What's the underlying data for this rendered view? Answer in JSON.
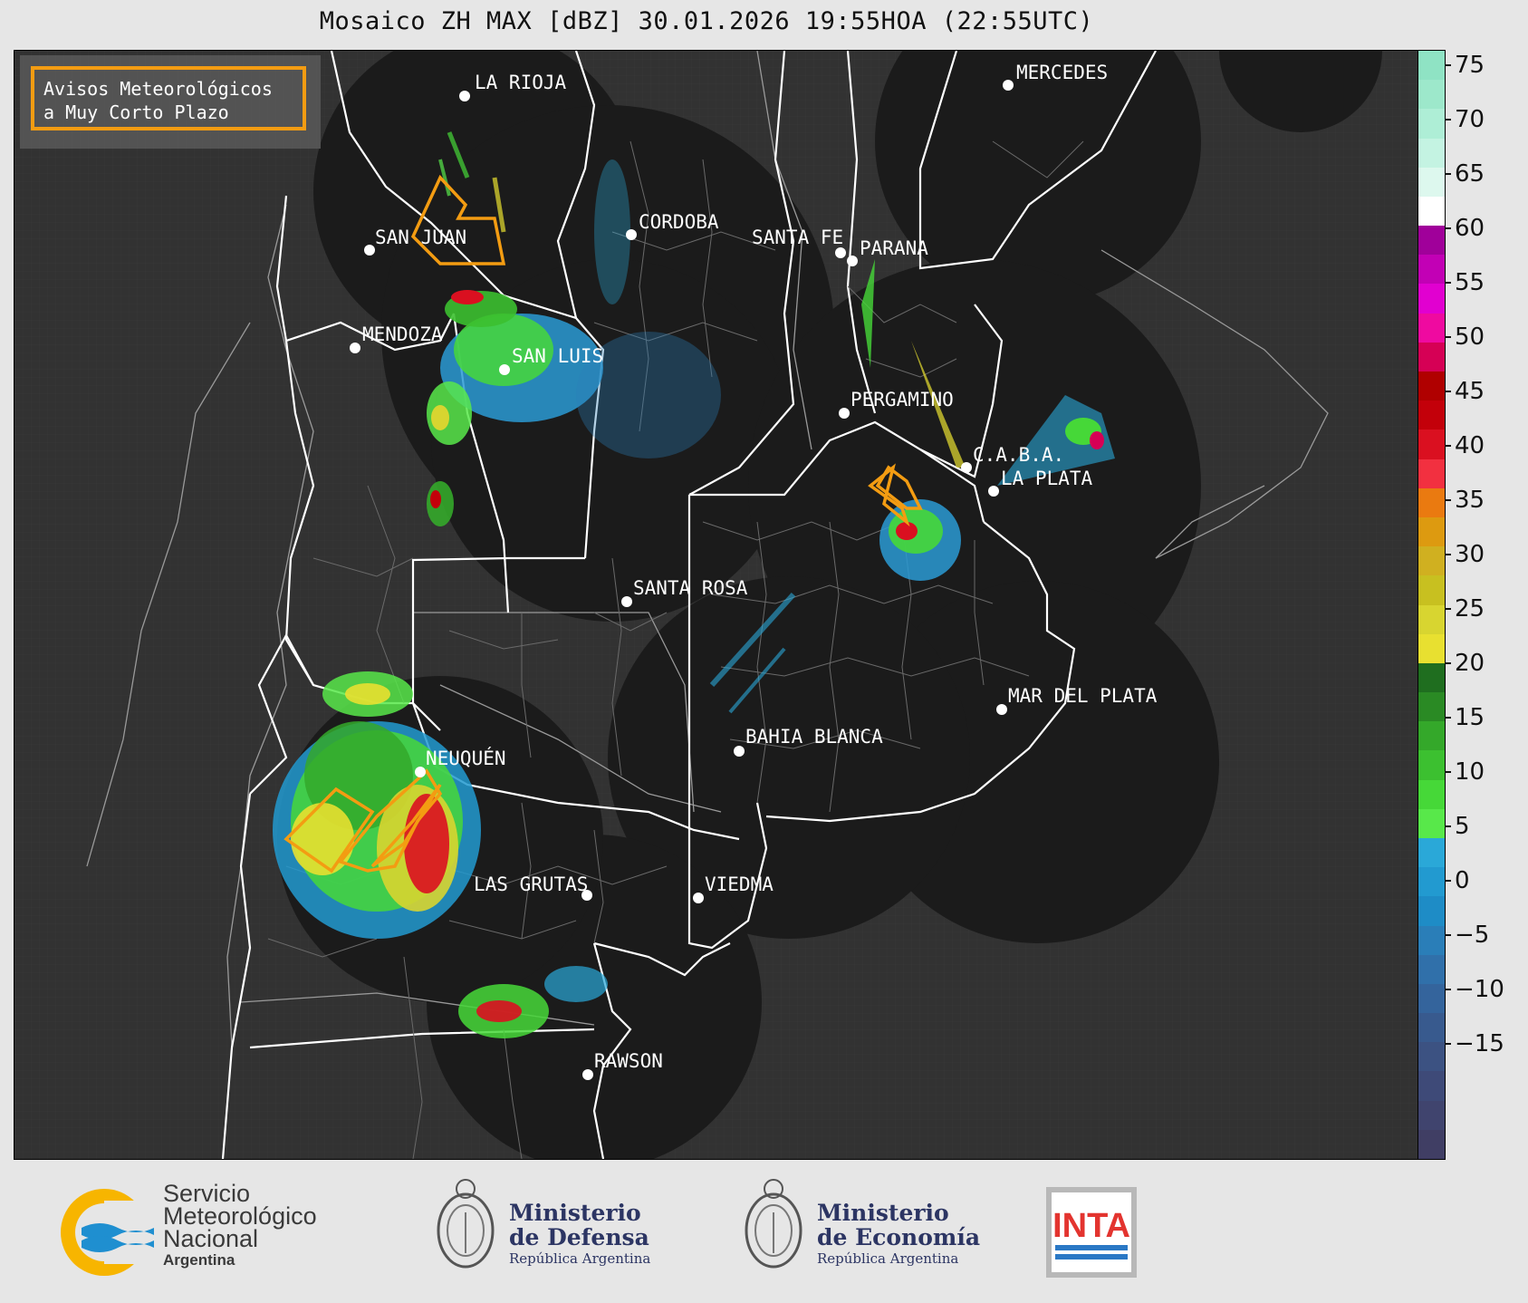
{
  "title": "Mosaico ZH MAX [dBZ] 30.01.2026 19:55HOA (22:55UTC)",
  "alert_box": {
    "line1": "Avisos Meteorológicos",
    "line2": "a Muy Corto Plazo",
    "border_color": "#f39c12"
  },
  "cities": [
    {
      "name": "LA RIOJA"
    },
    {
      "name": "SAN JUAN"
    },
    {
      "name": "CORDOBA"
    },
    {
      "name": "SANTA FE"
    },
    {
      "name": "PARANA"
    },
    {
      "name": "MERCEDES"
    },
    {
      "name": "MENDOZA"
    },
    {
      "name": "SAN LUIS"
    },
    {
      "name": "PERGAMINO"
    },
    {
      "name": "C.A.B.A."
    },
    {
      "name": "LA PLATA"
    },
    {
      "name": "SANTA ROSA"
    },
    {
      "name": "MAR DEL PLATA"
    },
    {
      "name": "BAHIA BLANCA"
    },
    {
      "name": "NEUQUÉN"
    },
    {
      "name": "LAS GRUTAS"
    },
    {
      "name": "VIEDMA"
    },
    {
      "name": "RAWSON"
    }
  ],
  "colorbar": {
    "unit": "dBZ",
    "ticks": [
      "75",
      "70",
      "65",
      "60",
      "55",
      "50",
      "45",
      "40",
      "35",
      "30",
      "25",
      "20",
      "15",
      "10",
      "5",
      "0",
      "−5",
      "−10",
      "−15"
    ],
    "segments": [
      "#8fe3c4",
      "#9de8cb",
      "#aeeed6",
      "#c4f3e2",
      "#ddf8ee",
      "#ffffff",
      "#a0009a",
      "#c200b5",
      "#e100d0",
      "#ef0aa0",
      "#d60055",
      "#b00000",
      "#c3000a",
      "#da1020",
      "#f23040",
      "#ea7a10",
      "#dd9a10",
      "#d0b020",
      "#c8c020",
      "#d8d530",
      "#e8e030",
      "#1f6e1f",
      "#2a8a24",
      "#34a82a",
      "#3cc030",
      "#46d838",
      "#58e84a",
      "#2aa8d8",
      "#229ad0",
      "#1e8cc6",
      "#2a7eb8",
      "#3070aa",
      "#34649c",
      "#385a8e",
      "#3c5282",
      "#3e4a78",
      "#40446e",
      "#403e64"
    ]
  },
  "footer": {
    "smn": {
      "line1": "Servicio",
      "line2": "Meteorológico",
      "line3": "Nacional",
      "line4": "Argentina"
    },
    "defensa": {
      "line1": "Ministerio",
      "line2": "de Defensa",
      "line3": "República Argentina"
    },
    "economia": {
      "line1": "Ministerio",
      "line2": "de Economía",
      "line3": "República Argentina"
    },
    "inta": {
      "label": "INTA"
    }
  }
}
